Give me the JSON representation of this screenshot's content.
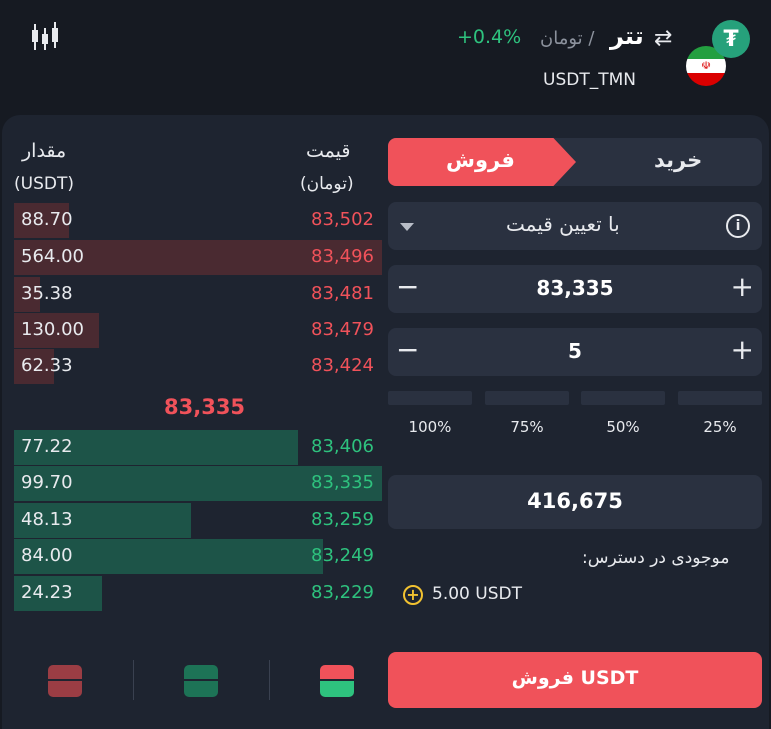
{
  "header": {
    "coin_name": "تتر",
    "quote_label": "/ تومان",
    "change": "+0.4%",
    "pair_code": "USDT_TMN",
    "coin_symbol": "₮",
    "flag_emblem": "☫"
  },
  "orderbook": {
    "amount_header": "مقدار",
    "amount_unit": "(USDT)",
    "price_header": "قیمت",
    "price_unit": "(تومان)",
    "asks": [
      {
        "amount": "88.70",
        "price": "83,502",
        "depth": 0.15
      },
      {
        "amount": "564.00",
        "price": "83,496",
        "depth": 1.0
      },
      {
        "amount": "35.38",
        "price": "83,481",
        "depth": 0.07
      },
      {
        "amount": "130.00",
        "price": "83,479",
        "depth": 0.23
      },
      {
        "amount": "62.33",
        "price": "83,424",
        "depth": 0.11
      }
    ],
    "mid_price": "83,335",
    "bids": [
      {
        "amount": "77.22",
        "price": "83,406",
        "depth": 0.77
      },
      {
        "amount": "99.70",
        "price": "83,335",
        "depth": 1.0
      },
      {
        "amount": "48.13",
        "price": "83,259",
        "depth": 0.48
      },
      {
        "amount": "84.00",
        "price": "83,249",
        "depth": 0.84
      },
      {
        "amount": "24.23",
        "price": "83,229",
        "depth": 0.24
      }
    ]
  },
  "trade": {
    "tab_buy": "خرید",
    "tab_sell": "فروش",
    "active_tab": "sell",
    "order_type": "با تعیین قیمت",
    "price_value": "83,335",
    "amount_value": "5",
    "stepper_minus": "−",
    "stepper_plus": "+",
    "percent_options": [
      "100%",
      "75%",
      "50%",
      "25%"
    ],
    "total_value": "416,675",
    "available_label": "موجودی در دسترس:",
    "available_value": "5.00 USDT",
    "submit_label": "فروش USDT"
  },
  "colors": {
    "sell": "#f0525a",
    "buy": "#2ec27e",
    "background": "#161a22",
    "panel": "#1e2430"
  },
  "icons": [
    "candlestick-chart-icon",
    "tether-icon",
    "iran-flag-icon",
    "swap-arrows-icon",
    "info-icon",
    "caret-down-icon",
    "add-circle-icon",
    "view-sell-only-icon",
    "view-buy-only-icon",
    "view-both-icon"
  ]
}
